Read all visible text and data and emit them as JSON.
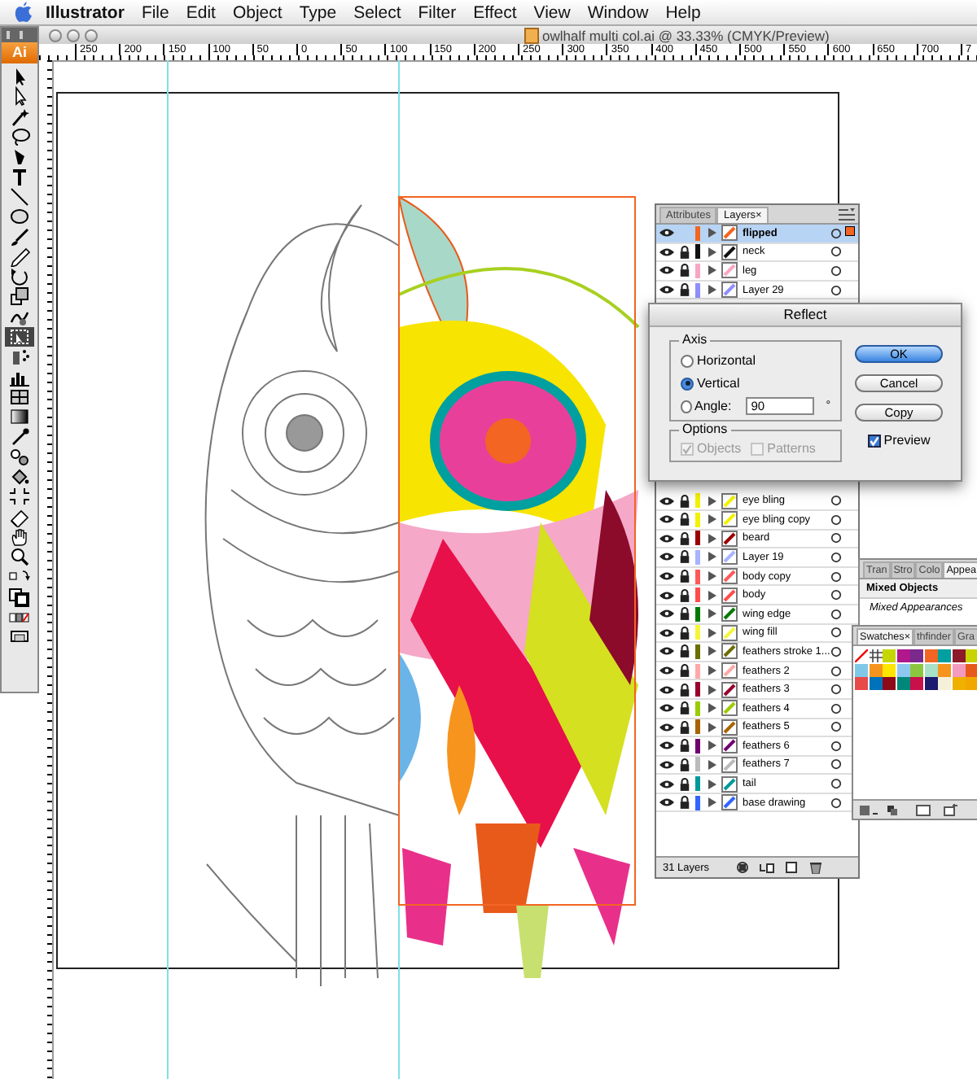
{
  "menu_bar": {
    "items": [
      {
        "label": "Illustrator",
        "kind": "app"
      },
      {
        "label": "File",
        "kind": "menu"
      },
      {
        "label": "Edit",
        "kind": "menu"
      },
      {
        "label": "Object",
        "kind": "menu"
      },
      {
        "label": "Type",
        "kind": "menu"
      },
      {
        "label": "Select",
        "kind": "menu"
      },
      {
        "label": "Filter",
        "kind": "menu"
      },
      {
        "label": "Effect",
        "kind": "menu"
      },
      {
        "label": "View",
        "kind": "menu"
      },
      {
        "label": "Window",
        "kind": "menu"
      },
      {
        "label": "Help",
        "kind": "menu"
      }
    ]
  },
  "document": {
    "title": "owlhalf multi col.ai @ 33.33% (CMYK/Preview)"
  },
  "ruler": {
    "labels": [
      "250",
      "200",
      "150",
      "100",
      "50",
      "0",
      "50",
      "100",
      "150",
      "200",
      "250",
      "300",
      "350",
      "400",
      "450",
      "500",
      "550",
      "600",
      "650",
      "700",
      "7"
    ]
  },
  "toolbox": {
    "logo": "Ai",
    "tools": [
      {
        "kind": "arrow",
        "selected": false
      },
      {
        "kind": "direct",
        "selected": false
      },
      {
        "kind": "wand",
        "selected": false
      },
      {
        "kind": "lasso",
        "selected": false
      },
      {
        "kind": "pen",
        "selected": false
      },
      {
        "kind": "type",
        "selected": false
      },
      {
        "kind": "line",
        "selected": false
      },
      {
        "kind": "ellipse",
        "selected": false
      },
      {
        "kind": "brush",
        "selected": false
      },
      {
        "kind": "pencil",
        "selected": false
      },
      {
        "kind": "rotate",
        "selected": false
      },
      {
        "kind": "scale",
        "selected": false
      },
      {
        "kind": "warp",
        "selected": false
      },
      {
        "kind": "transform",
        "selected": true
      },
      {
        "kind": "sprayer",
        "selected": false
      },
      {
        "kind": "graph",
        "selected": false
      },
      {
        "kind": "mesh",
        "selected": false
      },
      {
        "kind": "gradient",
        "selected": false
      },
      {
        "kind": "eyedropper",
        "selected": false
      },
      {
        "kind": "blend",
        "selected": false
      },
      {
        "kind": "paint",
        "selected": false
      },
      {
        "kind": "crop",
        "selected": false
      },
      {
        "kind": "eraser",
        "selected": false
      },
      {
        "kind": "hand",
        "selected": false
      },
      {
        "kind": "zoom",
        "selected": false
      },
      {
        "kind": "swap",
        "selected": false
      },
      {
        "kind": "fillstroke",
        "selected": false
      },
      {
        "kind": "colormode",
        "selected": false
      },
      {
        "kind": "screen",
        "selected": false
      }
    ]
  },
  "layers_panel": {
    "tabs": [
      {
        "label": "Attributes",
        "selected": false
      },
      {
        "label": "Layers",
        "selected": true,
        "close": "×"
      }
    ],
    "top_rows": [
      {
        "name": "flipped",
        "color": "#f26522",
        "locked": false,
        "selected": true
      },
      {
        "name": "neck",
        "color": "#111111",
        "locked": true,
        "selected": false
      },
      {
        "name": "leg",
        "color": "#f7a7c4",
        "locked": true,
        "selected": false
      },
      {
        "name": "Layer 29",
        "color": "#8f8fff",
        "locked": true,
        "selected": false
      }
    ],
    "bottom_rows": [
      {
        "name": "eye bling",
        "color": "#f2f200",
        "locked": true,
        "selected": false
      },
      {
        "name": "eye bling copy",
        "color": "#f2f200",
        "locked": true,
        "selected": false
      },
      {
        "name": "beard",
        "color": "#990000",
        "locked": true,
        "selected": false
      },
      {
        "name": "Layer 19",
        "color": "#a8b4ff",
        "locked": true,
        "selected": false
      },
      {
        "name": "body copy",
        "color": "#ff5a5a",
        "locked": true,
        "selected": false
      },
      {
        "name": "body",
        "color": "#ff4d4d",
        "locked": true,
        "selected": false
      },
      {
        "name": "wing edge",
        "color": "#007a00",
        "locked": true,
        "selected": false
      },
      {
        "name": "wing fill",
        "color": "#f5f53c",
        "locked": true,
        "selected": false
      },
      {
        "name": "feathers stroke 1...",
        "color": "#6e6e00",
        "locked": true,
        "selected": false
      },
      {
        "name": "feathers 2",
        "color": "#ffa8a8",
        "locked": true,
        "selected": false
      },
      {
        "name": "feathers 3",
        "color": "#99002e",
        "locked": true,
        "selected": false
      },
      {
        "name": "feathers 4",
        "color": "#9acc00",
        "locked": true,
        "selected": false
      },
      {
        "name": "feathers 5",
        "color": "#a86400",
        "locked": true,
        "selected": false
      },
      {
        "name": "feathers 6",
        "color": "#700070",
        "locked": true,
        "selected": false
      },
      {
        "name": "feathers 7",
        "color": "#bbbbbb",
        "locked": true,
        "selected": false
      },
      {
        "name": "tail",
        "color": "#009999",
        "locked": true,
        "selected": false
      },
      {
        "name": "base drawing",
        "color": "#2f66ff",
        "locked": true,
        "selected": false
      }
    ],
    "count": "31 Layers"
  },
  "reflect_dialog": {
    "title": "Reflect",
    "axis": {
      "legend": "Axis",
      "options": [
        {
          "label": "Horizontal",
          "selected": false
        },
        {
          "label": "Vertical",
          "selected": true
        },
        {
          "label": "Angle:",
          "selected": false
        }
      ],
      "angle": "90",
      "unit": "°"
    },
    "options": {
      "legend": "Options",
      "checks": [
        {
          "label": "Objects",
          "checked": true,
          "disabled": true
        },
        {
          "label": "Patterns",
          "checked": false,
          "disabled": true
        }
      ]
    },
    "buttons": [
      {
        "label": "OK",
        "default": true
      },
      {
        "label": "Cancel",
        "default": false
      },
      {
        "label": "Copy",
        "default": false
      }
    ],
    "preview": {
      "label": "Preview",
      "checked": true
    }
  },
  "appearance_panel": {
    "tabs": [
      {
        "label": "Tran",
        "selected": false
      },
      {
        "label": "Stro",
        "selected": false
      },
      {
        "label": "Colo",
        "selected": false
      },
      {
        "label": "Appea",
        "selected": true
      }
    ],
    "heading": "Mixed Objects",
    "note": "Mixed Appearances"
  },
  "swatches_panel": {
    "tabs": [
      {
        "label": "Swatches",
        "selected": true,
        "close": "×"
      },
      {
        "label": "thfinder",
        "selected": false
      },
      {
        "label": "Gra",
        "selected": false
      }
    ],
    "swatches": [
      {
        "kind": "none"
      },
      {
        "kind": "pattern"
      },
      {
        "kind": "color",
        "color": "#c6d600"
      },
      {
        "kind": "color",
        "color": "#b0188c"
      },
      {
        "kind": "color",
        "color": "#7a2a8c"
      },
      {
        "kind": "color",
        "color": "#f26522"
      },
      {
        "kind": "color",
        "color": "#00a0a0"
      },
      {
        "kind": "color",
        "color": "#8c1a2a"
      },
      {
        "kind": "color",
        "color": "#c8d400"
      },
      {
        "kind": "color",
        "color": "#7fc8e8"
      },
      {
        "kind": "color",
        "color": "#f7941d"
      },
      {
        "kind": "color",
        "color": "#ffe600"
      },
      {
        "kind": "color",
        "color": "#8ec8f0"
      },
      {
        "kind": "color",
        "color": "#8cc63f"
      },
      {
        "kind": "color",
        "color": "#a8e0c8"
      },
      {
        "kind": "color",
        "color": "#f7941d"
      },
      {
        "kind": "color",
        "color": "#f49ac1"
      },
      {
        "kind": "color",
        "color": "#e85a1a"
      },
      {
        "kind": "color",
        "color": "#e84a4a"
      },
      {
        "kind": "color",
        "color": "#0072bc"
      },
      {
        "kind": "color",
        "color": "#8c0a1a"
      },
      {
        "kind": "color",
        "color": "#00877a"
      },
      {
        "kind": "color",
        "color": "#c8104a"
      },
      {
        "kind": "color",
        "color": "#1a1a6e"
      },
      {
        "kind": "color",
        "color": "#f5f0d8"
      },
      {
        "kind": "color",
        "color": "#f0b000"
      },
      {
        "kind": "color",
        "color": "#f0a800"
      }
    ]
  }
}
